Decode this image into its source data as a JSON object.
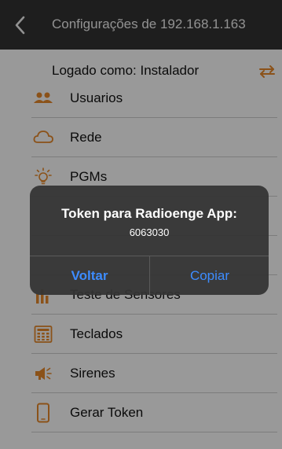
{
  "navbar": {
    "title": "Configurações de 192.168.1.163",
    "back_icon": "chevron-left-icon"
  },
  "session": {
    "logged_as": "Logado como: Instalador",
    "swap_icon": "swap-arrows-icon"
  },
  "menu": {
    "items": [
      {
        "label": "Usuarios",
        "icon": "users-icon"
      },
      {
        "label": "Rede",
        "icon": "cloud-icon"
      },
      {
        "label": "PGMs",
        "icon": "lightbulb-icon"
      },
      {
        "label": "",
        "icon": ""
      },
      {
        "label": "",
        "icon": ""
      },
      {
        "label": "Teste de Sensores",
        "icon": "bar-chart-icon"
      },
      {
        "label": "Teclados",
        "icon": "keypad-icon"
      },
      {
        "label": "Sirenes",
        "icon": "siren-icon"
      },
      {
        "label": "Gerar Token",
        "icon": "phone-icon"
      }
    ]
  },
  "alert": {
    "title": "Token para Radioenge App:",
    "message": "6063030",
    "buttons": {
      "back": "Voltar",
      "copy": "Copiar"
    }
  },
  "colors": {
    "navbar_bg": "#333333",
    "accent_orange": "#e8892a",
    "alert_button_blue": "#3d8cff"
  }
}
